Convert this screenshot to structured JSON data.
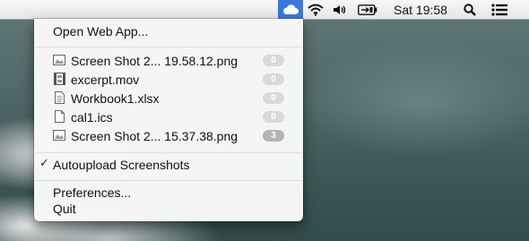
{
  "menubar": {
    "clock": "Sat 19:58",
    "icons": [
      "cloud-icon",
      "wifi-icon",
      "volume-icon",
      "battery-icon",
      "search-icon",
      "notification-list-icon"
    ],
    "accent_color": "#3a79d8"
  },
  "menu": {
    "open_web_app": "Open Web App...",
    "files": [
      {
        "name": "Screen Shot 2... 19.58.12.png",
        "count": "0",
        "icon": "image-file-icon"
      },
      {
        "name": "excerpt.mov",
        "count": "0",
        "icon": "movie-file-icon"
      },
      {
        "name": "Workbook1.xlsx",
        "count": "0",
        "icon": "document-file-icon"
      },
      {
        "name": "cal1.ics",
        "count": "0",
        "icon": "blank-file-icon"
      },
      {
        "name": "Screen Shot 2... 15.37.38.png",
        "count": "3",
        "icon": "image-file-icon"
      }
    ],
    "autoupload_checkmark": "✓",
    "autoupload": "Autoupload Screenshots",
    "preferences": "Preferences...",
    "quit": "Quit"
  }
}
